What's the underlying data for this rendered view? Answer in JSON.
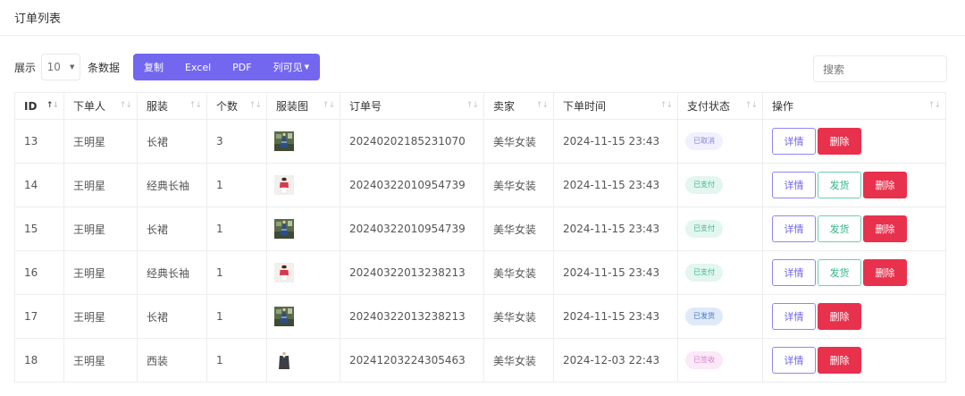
{
  "page": {
    "title": "订单列表"
  },
  "toolbar": {
    "show_label": "展示",
    "page_length": "10",
    "records_label": "条数据",
    "buttons": {
      "copy": "复制",
      "excel": "Excel",
      "pdf": "PDF",
      "columns": "列可见"
    },
    "search_placeholder": "搜索"
  },
  "table": {
    "headers": [
      "ID",
      "下单人",
      "服装",
      "个数",
      "服装图",
      "订单号",
      "卖家",
      "下单时间",
      "支付状态",
      "操作"
    ],
    "actions": {
      "detail": "详情",
      "ship": "发货",
      "delete": "删除"
    },
    "rows": [
      {
        "id": "13",
        "buyer": "王明星",
        "item": "长裙",
        "qty": "3",
        "image": "dress-thumbnail",
        "order_no": "20240202185231070",
        "seller": "美华女装",
        "time": "2024-11-15 23:43",
        "status": "已取消"
      },
      {
        "id": "14",
        "buyer": "王明星",
        "item": "经典长袖",
        "qty": "1",
        "image": "shirt-thumbnail",
        "order_no": "20240322010954739",
        "seller": "美华女装",
        "time": "2024-11-15 23:43",
        "status": "已支付"
      },
      {
        "id": "15",
        "buyer": "王明星",
        "item": "长裙",
        "qty": "1",
        "image": "dress-thumbnail",
        "order_no": "20240322010954739",
        "seller": "美华女装",
        "time": "2024-11-15 23:43",
        "status": "已支付"
      },
      {
        "id": "16",
        "buyer": "王明星",
        "item": "经典长袖",
        "qty": "1",
        "image": "shirt-thumbnail",
        "order_no": "20240322013238213",
        "seller": "美华女装",
        "time": "2024-11-15 23:43",
        "status": "已支付"
      },
      {
        "id": "17",
        "buyer": "王明星",
        "item": "长裙",
        "qty": "1",
        "image": "dress-thumbnail",
        "order_no": "20240322013238213",
        "seller": "美华女装",
        "time": "2024-11-15 23:43",
        "status": "已发货"
      },
      {
        "id": "18",
        "buyer": "王明星",
        "item": "西装",
        "qty": "1",
        "image": "suit-thumbnail",
        "order_no": "20241203224305463",
        "seller": "美华女装",
        "time": "2024-12-03 22:43",
        "status": "已签收"
      }
    ]
  },
  "colors": {
    "accent": "#7367f0",
    "danger": "#e8314d",
    "success": "#34b38a"
  }
}
